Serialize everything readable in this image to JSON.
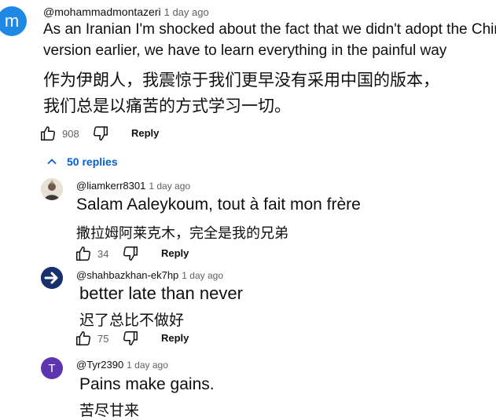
{
  "comment": {
    "avatar_letter": "m",
    "avatar_color": "#1e88e5",
    "handle": "@mohammadmontazeri",
    "time": "1 day ago",
    "text_en_line1": "As an Iranian I'm shocked about the fact that we didn't adopt the Chine",
    "text_en_line2": "version earlier, we have to learn everything in the painful way",
    "text_zh_line1": "作为伊朗人，我震惊于我们更早没有采用中国的版本，",
    "text_zh_line2": "我们总是以痛苦的方式学习一切。",
    "likes": "908",
    "reply_label": "Reply",
    "replies_label": "50 replies"
  },
  "replies": [
    {
      "handle": "@liamkerr8301",
      "time": "1 day ago",
      "text_en": "Salam Aaleykoum, tout à fait mon frère",
      "text_zh": "撒拉姆阿莱克木，完全是我的兄弟",
      "likes": "34",
      "reply_label": "Reply"
    },
    {
      "handle": "@shahbazkhan-ek7hp",
      "time": "1 day ago",
      "text_en": "better late than never",
      "text_zh": "迟了总比不做好",
      "likes": "75",
      "reply_label": "Reply"
    },
    {
      "avatar_letter": "T",
      "avatar_color": "#5e35b1",
      "handle": "@Tyr2390",
      "time": "1 day ago",
      "text_en": "Pains make gains.",
      "text_zh": "苦尽甘来"
    }
  ],
  "icons": {
    "like": "thumbs-up-icon",
    "dislike": "thumbs-down-icon",
    "collapse": "chevron-up-icon"
  }
}
